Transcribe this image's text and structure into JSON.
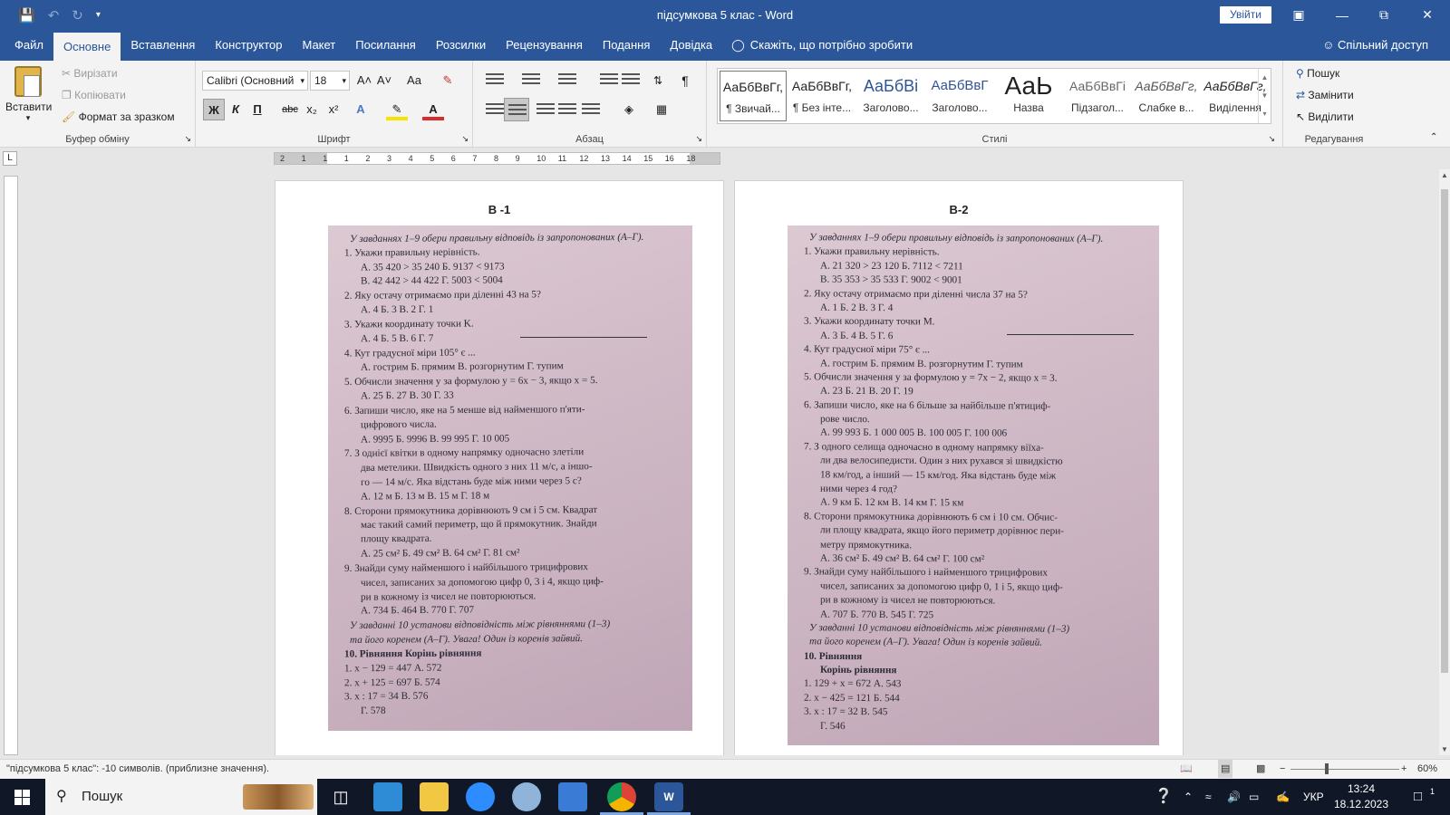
{
  "window": {
    "title": "підсумкова 5 клас  -  Word",
    "signin_label": "Увійти"
  },
  "menu": {
    "tabs": [
      "Файл",
      "Основне",
      "Вставлення",
      "Конструктор",
      "Макет",
      "Посилання",
      "Розсилки",
      "Рецензування",
      "Подання",
      "Довідка"
    ],
    "active_tab": "Основне",
    "tell_me": "Скажіть, що потрібно зробити",
    "share": "Спільний доступ"
  },
  "ribbon": {
    "clipboard": {
      "paste": "Вставити",
      "cut": "Вирізати",
      "copy": "Копіювати",
      "format_painter": "Формат за зразком",
      "label": "Буфер обміну"
    },
    "font": {
      "family": "Calibri (Основний",
      "size": "18",
      "bold": "Ж",
      "italic": "К",
      "underline": "П",
      "strike": "abc",
      "subscript": "x₂",
      "superscript": "x²",
      "grow": "A˄",
      "shrink": "A˅",
      "case": "Aa",
      "label": "Шрифт"
    },
    "paragraph": {
      "label": "Абзац",
      "pilcrow": "¶"
    },
    "styles": {
      "label": "Стилі",
      "items": [
        {
          "preview": "АаБбВвГг,",
          "name": "¶ Звичай..."
        },
        {
          "preview": "АаБбВвГг,",
          "name": "¶ Без інте..."
        },
        {
          "preview": "АаБбВі",
          "name": "Заголово..."
        },
        {
          "preview": "АаБбВвГ",
          "name": "Заголово..."
        },
        {
          "preview": "АаЬ",
          "name": "Назва"
        },
        {
          "preview": "АаБбВвГі",
          "name": "Підзагол..."
        },
        {
          "preview": "АаБбВвГг,",
          "name": "Слабке в..."
        },
        {
          "preview": "АаБбВвГг,",
          "name": "Виділення"
        }
      ]
    },
    "editing": {
      "find": "Пошук",
      "replace": "Замінити",
      "select": "Виділити",
      "label": "Редагування"
    }
  },
  "ruler": {
    "labels": [
      "2",
      "1",
      "1",
      "1",
      "2",
      "3",
      "4",
      "5",
      "6",
      "7",
      "8",
      "9",
      "10",
      "11",
      "12",
      "13",
      "14",
      "15",
      "16",
      "18"
    ]
  },
  "pages": [
    {
      "title": "В -1",
      "lines": [
        {
          "t": "У завданнях 1–9 обери правильну відповідь із запропонованих (А–Г).",
          "it": true
        },
        {
          "t": "1.  Укажи правильну нерівність."
        },
        {
          "t": "А. 35 420 > 35 240            Б. 9137 < 9173"
        },
        {
          "t": "В. 42 442 > 44 422            Г. 5003 < 5004"
        },
        {
          "t": "2.  Яку остачу отримаємо при діленні 43 на 5?"
        },
        {
          "t": "А. 4          Б. 3          В. 2          Г. 1"
        },
        {
          "t": "3.  Укажи координату точки K."
        },
        {
          "t": "А. 4     Б. 5     В. 6     Г. 7"
        },
        {
          "t": "4.  Кут градусної міри 105° є ..."
        },
        {
          "t": "А. гострим     Б. прямим     В. розгорнутим     Г. тупим"
        },
        {
          "t": "5.  Обчисли значення y за формулою y = 6x − 3, якщо x = 5."
        },
        {
          "t": "А. 25          Б. 27          В. 30          Г. 33"
        },
        {
          "t": "6.  Запиши число, яке на 5 менше від найменшого п'яти-"
        },
        {
          "t": "цифрового числа."
        },
        {
          "t": "А. 9995       Б. 9996       В. 99 995       Г. 10 005"
        },
        {
          "t": "7.  З однієї квітки в одному напрямку одночасно злетіли"
        },
        {
          "t": "два метелики. Швидкість одного з них 11 м/с, а іншо-"
        },
        {
          "t": "го — 14 м/с. Яка відстань буде між ними через 5 с?"
        },
        {
          "t": "А. 12 м        Б. 13 м        В. 15 м        Г. 18 м"
        },
        {
          "t": "8.  Сторони прямокутника дорівнюють 9 см і 5 см. Квадрат"
        },
        {
          "t": "має такий самий периметр, що й прямокутник. Знайди"
        },
        {
          "t": "площу квадрата."
        },
        {
          "t": "А. 25 см²       Б. 49 см²       В. 64 см²       Г. 81 см²"
        },
        {
          "t": "9.  Знайди суму найменшого і найбільшого трицифрових"
        },
        {
          "t": "чисел, записаних за допомогою цифр 0, 3 і 4, якщо циф-"
        },
        {
          "t": "ри в кожному із чисел не повторюються."
        },
        {
          "t": "А. 734          Б. 464          В. 770          Г. 707"
        },
        {
          "t": "У завданні 10 установи відповідність між рівняннями (1–3)",
          "it": true
        },
        {
          "t": "та його коренем (А–Г). Увага! Один із коренів зайвий.",
          "it": true
        },
        {
          "t": "10.  Рівняння                          Корінь рівняння",
          "b": true
        },
        {
          "t": "1. x − 129 = 447                А. 572"
        },
        {
          "t": "2. x + 125 = 697                Б. 574"
        },
        {
          "t": "3. x : 17 = 34                     В. 576"
        },
        {
          "t": "                                              Г. 578"
        }
      ]
    },
    {
      "title": "В-2",
      "lines": [
        {
          "t": "У завданнях 1–9 обери правильну відповідь із запропонованих (А–Г).",
          "it": true
        },
        {
          "t": "1.  Укажи правильну нерівність."
        },
        {
          "t": "А. 21 320 > 23 120                 Б. 7112 < 7211"
        },
        {
          "t": "В. 35 353 > 35 533                 Г. 9002 < 9001"
        },
        {
          "t": "2.  Яку остачу отримаємо при діленні числа 37 на 5?"
        },
        {
          "t": "А. 1          Б. 2          В. 3          Г. 4"
        },
        {
          "t": "3.  Укажи координату точки M."
        },
        {
          "t": "А. 3     Б. 4     В. 5     Г. 6"
        },
        {
          "t": "4.  Кут градусної міри 75° є ..."
        },
        {
          "t": "А. гострим     Б. прямим     В. розгорнутим     Г. тупим"
        },
        {
          "t": "5.  Обчисли значення y за формулою y = 7x − 2, якщо x = 3."
        },
        {
          "t": "А. 23          Б. 21          В. 20          Г. 19"
        },
        {
          "t": "6.  Запиши число, яке на 6 більше за найбільше п'ятициф-"
        },
        {
          "t": "рове число."
        },
        {
          "t": "А. 99 993     Б. 1 000 005     В. 100 005     Г. 100 006"
        },
        {
          "t": "7.  З одного селища одночасно в одному напрямку віїха-"
        },
        {
          "t": "ли два велосипедисти. Один з них рухався зі швидкістю"
        },
        {
          "t": "18 км/год, а інший — 15 км/год. Яка відстань буде між"
        },
        {
          "t": "ними через 4 год?"
        },
        {
          "t": "А. 9 км        Б. 12 км        В. 14 км        Г. 15 км"
        },
        {
          "t": "8.  Сторони прямокутника дорівнюють 6 см і 10 см. Обчис-"
        },
        {
          "t": "ли площу квадрата, якщо його периметр дорівнює пери-"
        },
        {
          "t": "метру прямокутника."
        },
        {
          "t": "А. 36 см²       Б. 49 см²       В. 64 см²       Г. 100 см²"
        },
        {
          "t": "9.  Знайди суму найбільшого і найменшого трицифрових"
        },
        {
          "t": "чисел, записаних за допомогою цифр 0, 1 і 5, якщо циф-"
        },
        {
          "t": "ри в кожному із чисел не повторюються."
        },
        {
          "t": "А. 707          Б. 770          В. 545          Г. 725"
        },
        {
          "t": "У завданні 10 установи відповідність між рівняннями (1–3)",
          "it": true
        },
        {
          "t": "та його коренем (А–Г). Увага! Один із коренів зайвий.",
          "it": true
        },
        {
          "t": "10.  Рівняння",
          "b": true
        },
        {
          "t": "                                          Корінь рівняння",
          "b": true
        },
        {
          "t": "1. 129 + x = 672                 А. 543"
        },
        {
          "t": "2. x − 425 = 121                 Б. 544"
        },
        {
          "t": "3. x : 17 = 32                      В. 545"
        },
        {
          "t": "                                             Г. 546"
        }
      ]
    }
  ],
  "status": {
    "left": "\"підсумкова 5 клас\": -10 символів. (приблизне значення).",
    "zoom": "60%"
  },
  "taskbar": {
    "search": "Пошук",
    "lang": "УКР",
    "time": "13:24",
    "date": "18.12.2023",
    "notifications": "1"
  },
  "colors": {
    "title_bar": "#2b579a",
    "ribbon_bg": "#f3f3f3",
    "taskbar": "#101827"
  }
}
